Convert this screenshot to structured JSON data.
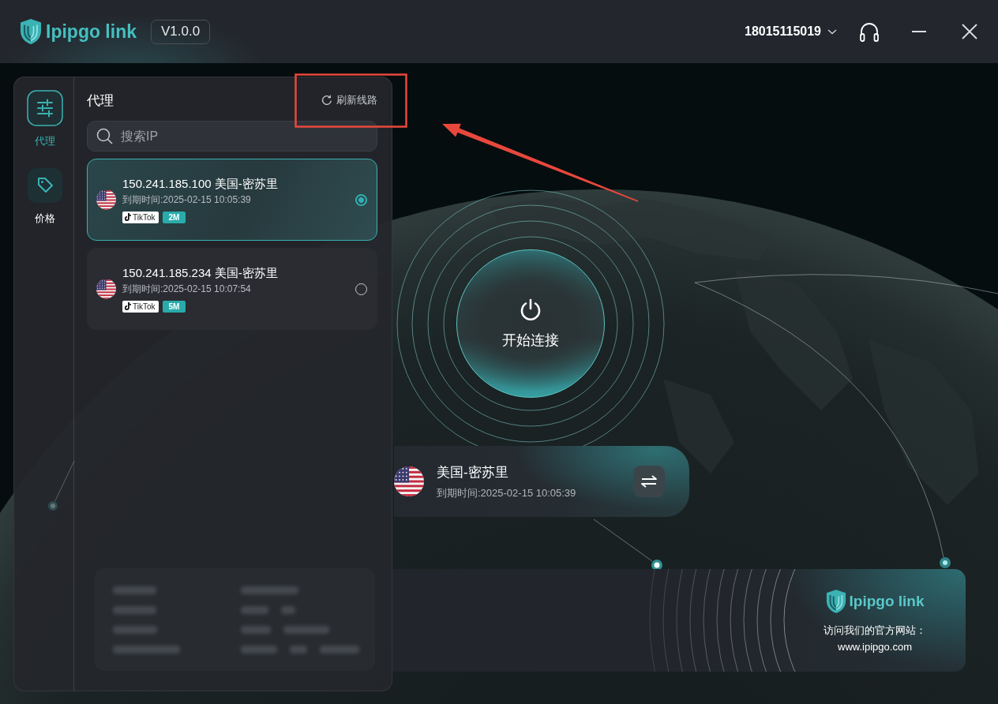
{
  "window": {
    "brand": "Ipipgo link",
    "version": "V1.0.0"
  },
  "account": {
    "phone": "18015115019"
  },
  "sidebar": {
    "items": [
      {
        "label": "代理",
        "selected": true
      },
      {
        "label": "价格",
        "selected": false
      }
    ]
  },
  "proxy_panel": {
    "title": "代理",
    "refresh_label": "刷新线路",
    "search": {
      "placeholder": "搜索IP"
    },
    "proxies": [
      {
        "address": "150.241.185.100 美国-密苏里",
        "expiry": "到期时间:2025-02-15 10:05:39",
        "tags": [
          {
            "kind": "platform",
            "label": "TikTok"
          },
          {
            "kind": "bandwidth",
            "label": "2M"
          }
        ],
        "selected": true
      },
      {
        "address": "150.241.185.234 美国-密苏里",
        "expiry": "到期时间:2025-02-15 10:07:54",
        "tags": [
          {
            "kind": "platform",
            "label": "TikTok"
          },
          {
            "kind": "bandwidth",
            "label": "5M"
          }
        ],
        "selected": false
      }
    ]
  },
  "connect_button": {
    "label": "开始连接"
  },
  "current_location": {
    "location": "美国-密苏里",
    "expiry": "到期时间:2025-02-15 10:05:39"
  },
  "banner": {
    "brand": "Ipipgo link",
    "caption": "访问我们的官方网站：",
    "url": "www.ipipgo.com"
  }
}
